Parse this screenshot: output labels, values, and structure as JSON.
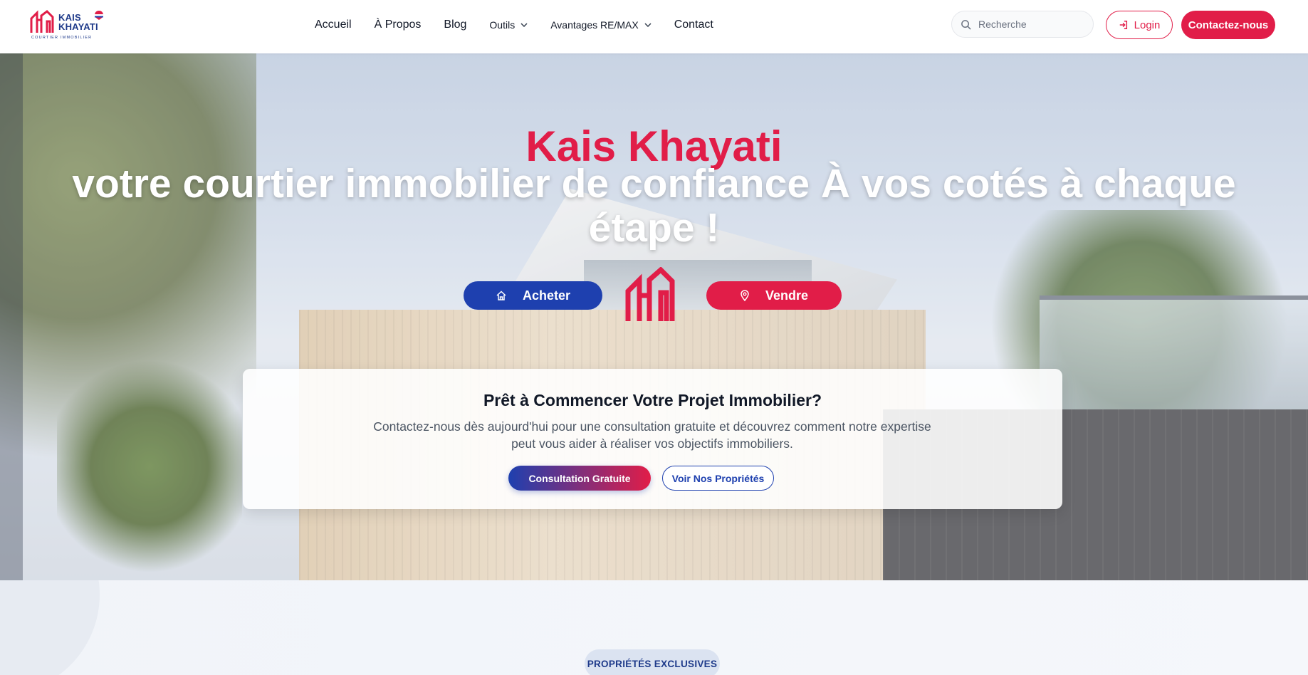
{
  "brand": {
    "name_line1": "KAIS",
    "name_line2": "KHAYATI",
    "tagline": "COURTIER IMMOBILIER",
    "color_red": "#e11d48",
    "color_blue": "#1e40af"
  },
  "nav": {
    "items": [
      {
        "label": "Accueil"
      },
      {
        "label": "À Propos"
      },
      {
        "label": "Blog"
      },
      {
        "label": "Outils",
        "dropdown": true
      },
      {
        "label": "Avantages RE/MAX",
        "dropdown": true
      },
      {
        "label": "Contact"
      }
    ],
    "search_placeholder": "Recherche",
    "login_label": "Login",
    "contact_label": "Contactez-nous"
  },
  "hero": {
    "name": "Kais Khayati",
    "tagline": "votre courtier immobilier de confiance À vos cotés à chaque étape !",
    "buy_label": "Acheter",
    "sell_label": "Vendre"
  },
  "cta": {
    "title": "Prêt à Commencer Votre Projet Immobilier?",
    "text": "Contactez-nous dès aujourd'hui pour une consultation gratuite et découvrez comment notre expertise peut vous aider à réaliser vos objectifs immobiliers.",
    "primary_label": "Consultation Gratuite",
    "secondary_label": "Voir Nos Propriétés"
  },
  "section": {
    "badge": "PROPRIÉTÉS EXCLUSIVES"
  }
}
